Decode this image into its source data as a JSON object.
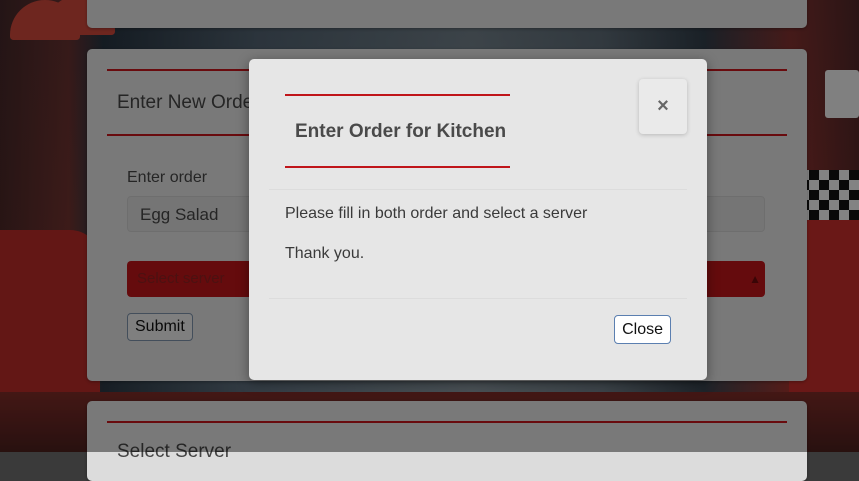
{
  "background_card": {
    "title": "Enter New Order",
    "order_label": "Enter order",
    "order_value": "Egg Salad",
    "server_placeholder": "Select server",
    "submit_label": "Submit",
    "bottom_title": "Select Server"
  },
  "modal": {
    "title": "Enter Order for Kitchen",
    "close_icon_glyph": "×",
    "message": "Please fill in both order and select a server",
    "thanks": "Thank you.",
    "close_label": "Close"
  },
  "colors": {
    "accent_red": "#c0151a",
    "select_red": "#b81418",
    "modal_bg": "#e6e6e6"
  }
}
